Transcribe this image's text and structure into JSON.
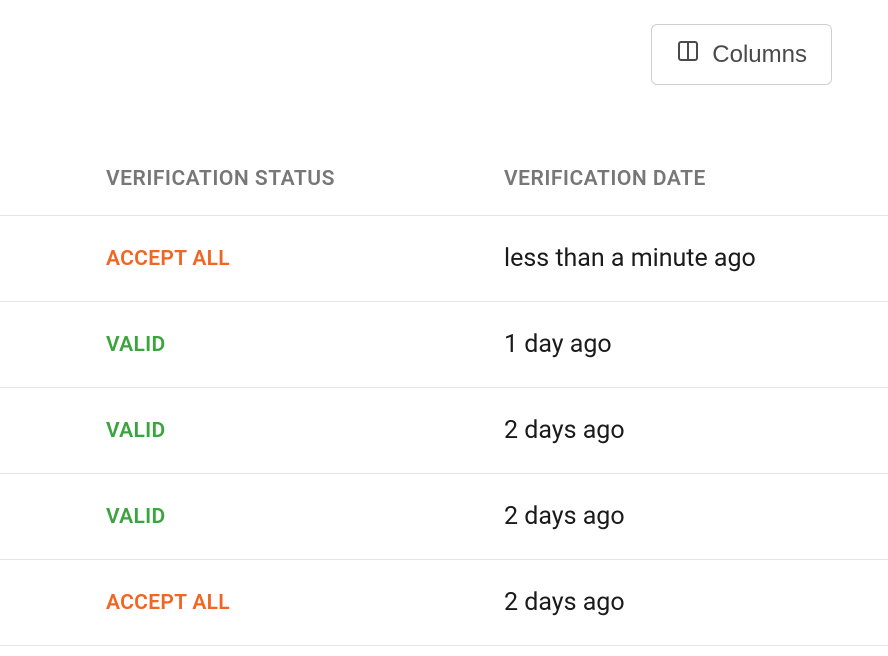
{
  "toolbar": {
    "columns_label": "Columns"
  },
  "table": {
    "headers": {
      "status": "VERIFICATION STATUS",
      "date": "VERIFICATION DATE"
    },
    "rows": [
      {
        "status_label": "ACCEPT ALL",
        "status_kind": "accept-all",
        "date_label": "less than a minute ago"
      },
      {
        "status_label": "VALID",
        "status_kind": "valid",
        "date_label": "1 day ago"
      },
      {
        "status_label": "VALID",
        "status_kind": "valid",
        "date_label": "2 days ago"
      },
      {
        "status_label": "VALID",
        "status_kind": "valid",
        "date_label": "2 days ago"
      },
      {
        "status_label": "ACCEPT ALL",
        "status_kind": "accept-all",
        "date_label": "2 days ago"
      }
    ]
  }
}
